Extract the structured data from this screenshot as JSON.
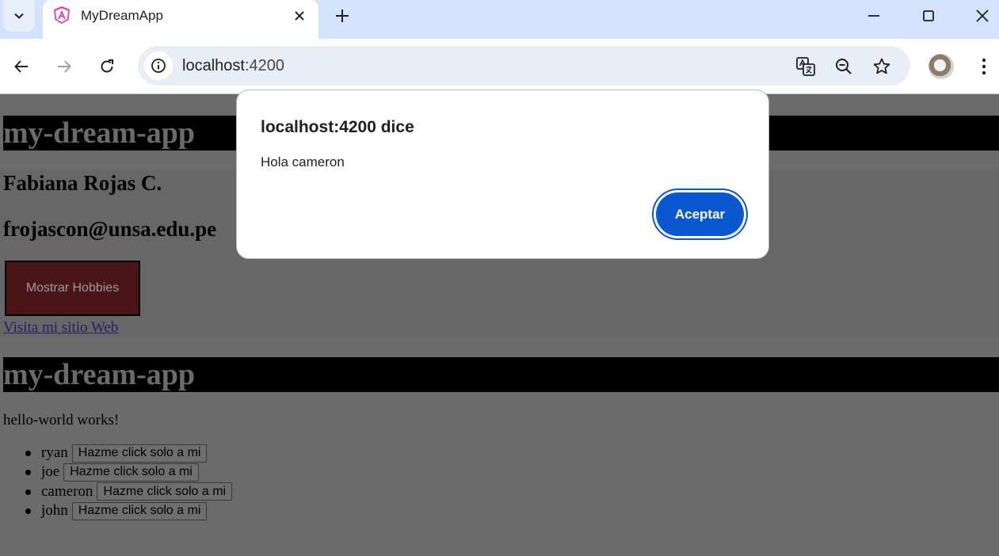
{
  "browser": {
    "tab_title": "MyDreamApp",
    "url_host": "localhost",
    "url_port": ":4200"
  },
  "page": {
    "app_title_1": "my-dream-app",
    "name_heading": "Fabiana Rojas C.",
    "email_heading": "frojascon@unsa.edu.pe",
    "hobbies_button": "Mostrar Hobbies",
    "website_link": "Visita mi sitio Web",
    "app_title_2": "my-dream-app",
    "hello_text": "hello-world works!",
    "items": [
      {
        "name": "ryan",
        "button": "Hazme click solo a mi"
      },
      {
        "name": "joe",
        "button": "Hazme click solo a mi"
      },
      {
        "name": "cameron",
        "button": "Hazme click solo a mi"
      },
      {
        "name": "john",
        "button": "Hazme click solo a mi"
      }
    ]
  },
  "dialog": {
    "title": "localhost:4200 dice",
    "message": "Hola cameron",
    "ok_label": "Aceptar"
  },
  "colors": {
    "accent": "#0b57d0",
    "tabbar": "#d3e3fd",
    "overlay_bg": "#6b6b6b",
    "hobbies_button_bg": "#4b1517"
  }
}
